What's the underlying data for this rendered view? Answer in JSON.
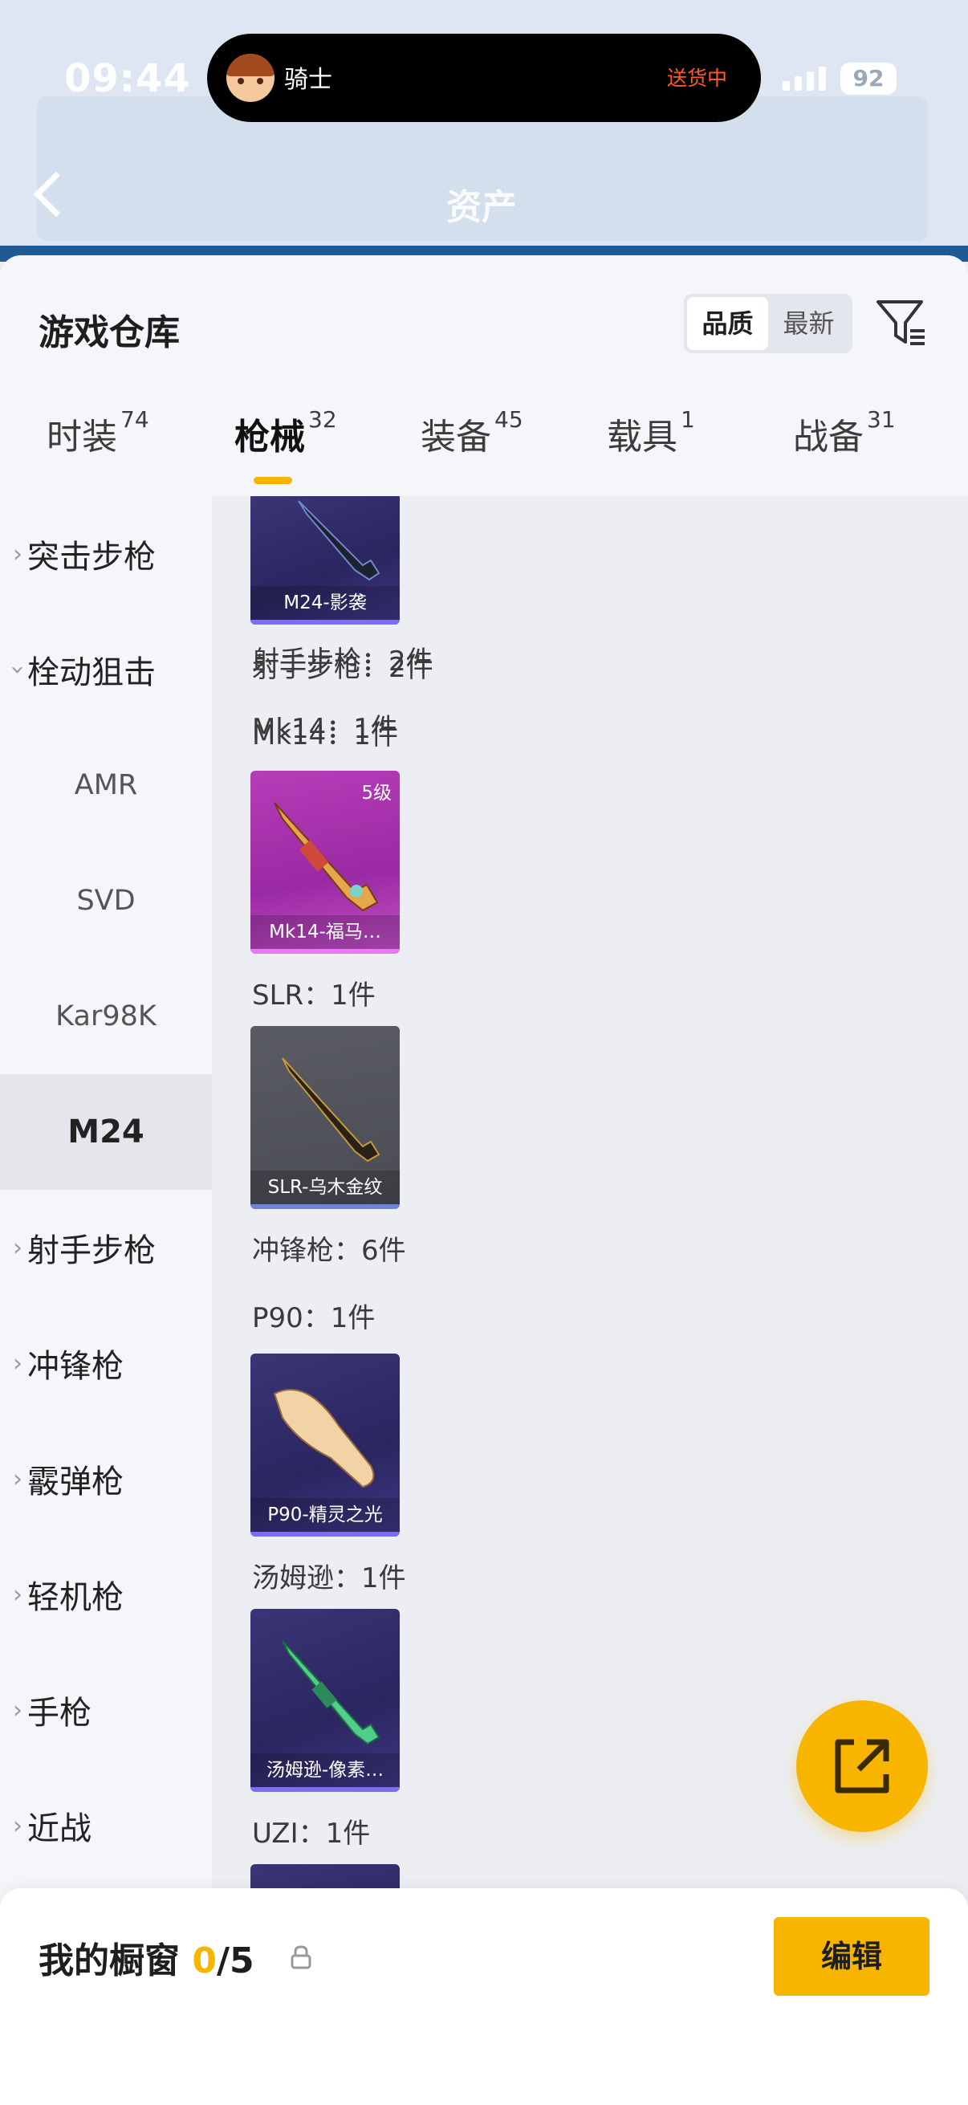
{
  "status_bar": {
    "time": "09:44",
    "battery": "92"
  },
  "live_activity": {
    "name": "骑士",
    "status": "送货中"
  },
  "header": {
    "title": "资产"
  },
  "sheet": {
    "title": "游戏仓库",
    "sort": {
      "options": [
        "品质",
        "最新"
      ],
      "selected": "品质"
    }
  },
  "tabs": [
    {
      "label": "时装",
      "count": "74"
    },
    {
      "label": "枪械",
      "count": "32",
      "active": true
    },
    {
      "label": "装备",
      "count": "45"
    },
    {
      "label": "载具",
      "count": "1"
    },
    {
      "label": "战备",
      "count": "31"
    }
  ],
  "sidebar": {
    "items": [
      {
        "label": "突击步枪"
      },
      {
        "label": "栓动狙击"
      },
      {
        "label": "AMR"
      },
      {
        "label": "SVD"
      },
      {
        "label": "Kar98K"
      },
      {
        "label": "M24"
      },
      {
        "label": "射手步枪"
      },
      {
        "label": "冲锋枪"
      },
      {
        "label": "霰弹枪"
      },
      {
        "label": "轻机枪"
      },
      {
        "label": "手枪"
      },
      {
        "label": "近战"
      }
    ]
  },
  "content": {
    "cards": [
      {
        "name": "M24-影袭",
        "level": ""
      },
      {
        "name": "Mk14-福马…",
        "level": "5级"
      },
      {
        "name": "SLR-乌木金纹",
        "level": ""
      },
      {
        "name": "P90-精灵之光",
        "level": ""
      },
      {
        "name": "汤姆逊-像素…",
        "level": ""
      }
    ],
    "group_headers": [
      "射手步枪：2件",
      "Mk14：1件",
      "SLR：1件",
      "冲锋枪：6件",
      "P90：1件",
      "汤姆逊：1件",
      "UZI：1件"
    ]
  },
  "bottom_bar": {
    "title": "我的橱窗",
    "count_current": "0",
    "count_total": "/5",
    "edit_label": "编辑"
  },
  "colors": {
    "accent": "#f7b500",
    "purple_card": "#2b2660",
    "pink_card": "#9a2aa3"
  }
}
